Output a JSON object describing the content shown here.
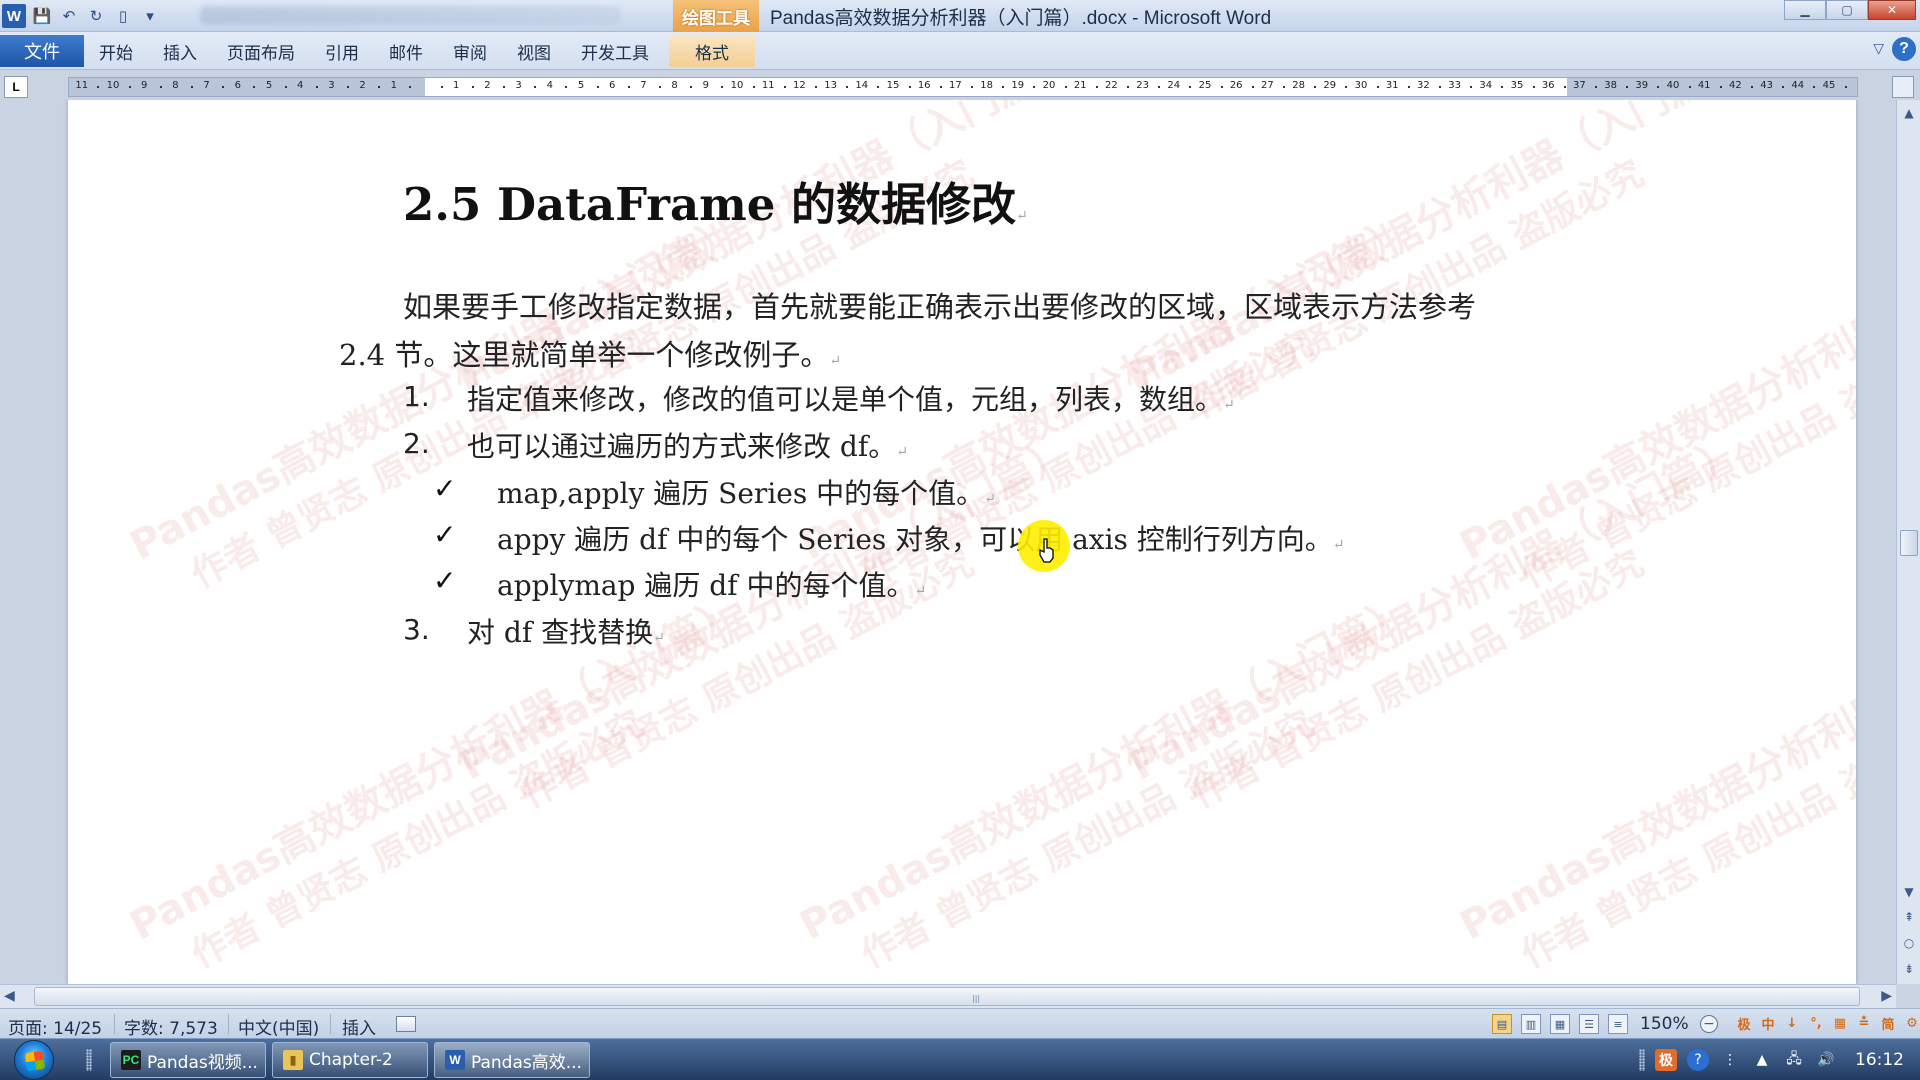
{
  "window": {
    "title": "Pandas高效数据分析利器（入门篇）.docx - Microsoft Word",
    "context_tab_group": "绘图工具",
    "app_icon": "W"
  },
  "ribbon": {
    "file_tab": "文件",
    "tabs": [
      "开始",
      "插入",
      "页面布局",
      "引用",
      "邮件",
      "审阅",
      "视图",
      "开发工具"
    ],
    "context_tab": "格式"
  },
  "ruler": {
    "tab_selector": "L",
    "left_labels": [
      "11",
      "10",
      "9",
      "8",
      "7",
      "6",
      "5",
      "4",
      "3",
      "2",
      "1"
    ],
    "right_labels": [
      "1",
      "2",
      "3",
      "4",
      "5",
      "6",
      "7",
      "8",
      "9",
      "10",
      "11",
      "12",
      "13",
      "14",
      "15",
      "16",
      "17",
      "18",
      "19",
      "20",
      "21",
      "22",
      "23",
      "24",
      "25",
      "26",
      "27",
      "28",
      "29",
      "30",
      "31",
      "32",
      "33",
      "34",
      "35",
      "36",
      "37",
      "38",
      "39",
      "40",
      "41",
      "42",
      "43",
      "44",
      "45"
    ]
  },
  "document": {
    "heading": "2.5 DataFrame 的数据修改",
    "intro_line1": "如果要手工修改指定数据，首先就要能正确表示出要修改的区域，区域表示方法参考",
    "intro_line2": "2.4 节。这里就简单举一个修改例子。",
    "numbered": [
      {
        "num": "1.",
        "text": "指定值来修改，修改的值可以是单个值，元组，列表，数组。"
      },
      {
        "num": "2.",
        "text": "也可以通过遍历的方式来修改 df。"
      },
      {
        "num": "3.",
        "text": "对 df 查找替换"
      }
    ],
    "checks": [
      {
        "mark": "✓",
        "text": "map,apply 遍历 Series 中的每个值。"
      },
      {
        "mark": "✓",
        "text": "appy 遍历 df 中的每个 Series 对象，可以用 axis 控制行列方向。"
      },
      {
        "mark": "✓",
        "text": "applymap 遍历 df 中的每个值。"
      }
    ],
    "paragraph_mark": "↵",
    "watermark_line1": "Pandas高效数据分析利器（入门篇）",
    "watermark_line2": "作者 曾贤志   原创出品  盗版必究"
  },
  "statusbar": {
    "page": "页面: 14/25",
    "words": "字数: 7,573",
    "language": "中文(中国)",
    "mode": "插入",
    "zoom": "150%",
    "ime": [
      "极",
      "中",
      "↓",
      "°,",
      "▦",
      "≛",
      "简",
      "⚙"
    ]
  },
  "taskbar": {
    "buttons": [
      {
        "label": "Pandas视频...",
        "icon": "pycharm-icon"
      },
      {
        "label": "Chapter-2",
        "icon": "folder-icon"
      },
      {
        "label": "Pandas高效...",
        "icon": "word-icon"
      }
    ],
    "clock": "16:12",
    "tray_ime": "极"
  },
  "colors": {
    "word_blue": "#2a5fb0",
    "context_orange": "#e9a249",
    "cursor_highlight": "#ffee00"
  }
}
